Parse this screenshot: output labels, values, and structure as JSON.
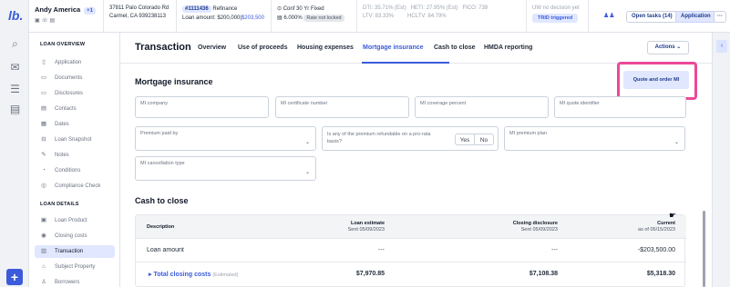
{
  "rail": {
    "logo": "lb.",
    "icons": [
      "search-icon",
      "inbox-icon",
      "list-icon",
      "document-icon"
    ],
    "add_label": "+"
  },
  "header": {
    "borrower": {
      "name": "Andy America",
      "badge": "+1",
      "contact_icons": "▣ ☏ ▤"
    },
    "address": {
      "line1": "37811 Palo Colorado Rd",
      "line2": "Carmel, CA 939238113"
    },
    "loan": {
      "id": "#1111436",
      "purpose": "Refinance",
      "amount_label": "Loan amount: $200,000",
      "amount_link": "$203,500"
    },
    "product": {
      "line1": "Conf 30 Yr Fixed",
      "rate": "6.000%",
      "lock": "Rate not locked"
    },
    "ratios": {
      "dti": "DTI: 35.71%",
      "dti_est": "(Est)",
      "ltv": "LTV: 83.33%",
      "heti": "HETI: 27.95%",
      "heti_est": "(Est)",
      "hcltv": "HCLTV: 84.79%",
      "fico": "FICO: 739"
    },
    "uw": {
      "status": "UW no decision yet",
      "trid": "TRID triggered"
    },
    "open_tasks": "Open tasks (14)",
    "application": "Application",
    "more": "···"
  },
  "sidebar": {
    "overview_heading": "LOAN OVERVIEW",
    "overview": [
      {
        "label": "Application",
        "icon": "▯"
      },
      {
        "label": "Documents",
        "icon": "▭"
      },
      {
        "label": "Disclosures",
        "icon": "▭"
      },
      {
        "label": "Contacts",
        "icon": "▤"
      },
      {
        "label": "Dates",
        "icon": "▦"
      },
      {
        "label": "Loan Snapshot",
        "icon": "⊟"
      },
      {
        "label": "Notes",
        "icon": "✎"
      },
      {
        "label": "Conditions",
        "icon": "◔"
      },
      {
        "label": "Compliance Check",
        "icon": "◎"
      }
    ],
    "details_heading": "LOAN DETAILS",
    "details": [
      {
        "label": "Loan Product",
        "icon": "▣"
      },
      {
        "label": "Closing costs",
        "icon": "◉"
      },
      {
        "label": "Transaction",
        "icon": "▥",
        "active": true
      },
      {
        "label": "Subject Property",
        "icon": "⌂"
      },
      {
        "label": "Borrowers",
        "icon": "♙"
      }
    ]
  },
  "main": {
    "title": "Transaction",
    "tabs": [
      "Overview",
      "Use of proceeds",
      "Housing expenses",
      "Mortgage insurance",
      "Cash to close",
      "HMDA reporting"
    ],
    "active_tab": "Mortgage insurance",
    "actions_label": "Actions ⌄",
    "mi": {
      "title": "Mortgage insurance",
      "quote_button": "Quote and order MI",
      "highlight_color": "#ec4899",
      "fields": {
        "company": "MI company",
        "certificate": "MI certificate number",
        "coverage": "MI coverage percent",
        "quote_id": "MI quote identifier",
        "premium_paid_by": "Premium paid by",
        "refundable_question": "Is any of the premium refundable on a pro-rata basis?",
        "yes": "Yes",
        "no": "No",
        "premium_plan": "MI premium plan",
        "cancellation": "MI cancellation type"
      }
    },
    "cash_to_close": {
      "title": "Cash to close",
      "columns": {
        "description": "Description",
        "loan_estimate": "Loan estimate",
        "loan_estimate_sub": "Sent 05/09/2023",
        "closing_disclosure": "Closing disclosure",
        "closing_disclosure_sub": "Sent 05/09/2023",
        "current": "Current",
        "current_sub": "as of 05/15/2023"
      },
      "rows": [
        {
          "label": "Loan amount",
          "le": "---",
          "cd": "---",
          "current": "-$203,500.00"
        },
        {
          "label": "Total closing costs",
          "note": "(Estimated)",
          "le": "$7,970.85",
          "cd": "$7,108.38",
          "current": "$5,318.30"
        }
      ]
    }
  },
  "colors": {
    "accent": "#3b5bdb",
    "highlight": "#ec4899"
  }
}
